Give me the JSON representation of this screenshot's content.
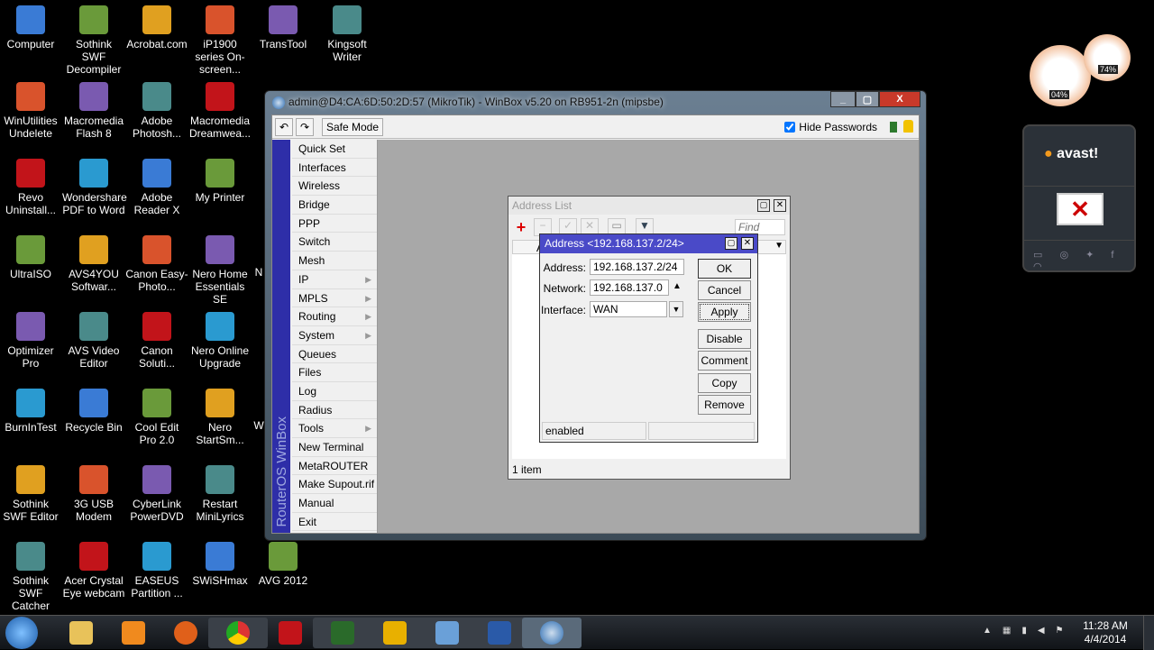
{
  "desktop": {
    "columns": [
      [
        "Computer",
        "WinUtilities Undelete",
        "Revo Uninstall...",
        "UltraISO",
        "Optimizer Pro",
        "BurnInTest",
        "Sothink SWF Editor",
        "Sothink SWF Catcher"
      ],
      [
        "Sothink SWF Decompiler",
        "Macromedia Flash 8",
        "Wondershare PDF to Word",
        "AVS4YOU Softwar...",
        "AVS Video Editor",
        "Recycle Bin",
        "3G USB Modem",
        "Acer Crystal Eye webcam"
      ],
      [
        "Acrobat.com",
        "Adobe Photosh...",
        "Adobe Reader X",
        "Canon Easy-Photo...",
        "Canon Soluti...",
        "Cool Edit Pro 2.0",
        "CyberLink PowerDVD",
        "EASEUS Partition ..."
      ],
      [
        "iP1900 series On-screen...",
        "Macromedia Dreamwea...",
        "My Printer",
        "Nero Home Essentials SE",
        "Nero Online Upgrade",
        "Nero StartSm...",
        "Restart MiniLyrics",
        "SWiSHmax"
      ],
      [
        "TransTool",
        null,
        null,
        "N",
        null,
        "W",
        null,
        "AVG 2012"
      ],
      [
        "Kingsoft Writer"
      ]
    ]
  },
  "winbox": {
    "title": "admin@D4:CA:6D:50:2D:57 (MikroTik) - WinBox v5.20 on RB951-2n (mipsbe)",
    "safe_mode": "Safe Mode",
    "hide_passwords": "Hide Passwords",
    "hide_passwords_checked": true,
    "brand": "RouterOS WinBox",
    "menu": [
      {
        "label": "Quick Set"
      },
      {
        "label": "Interfaces"
      },
      {
        "label": "Wireless"
      },
      {
        "label": "Bridge"
      },
      {
        "label": "PPP"
      },
      {
        "label": "Switch"
      },
      {
        "label": "Mesh"
      },
      {
        "label": "IP",
        "sub": true
      },
      {
        "label": "MPLS",
        "sub": true
      },
      {
        "label": "Routing",
        "sub": true
      },
      {
        "label": "System",
        "sub": true
      },
      {
        "label": "Queues"
      },
      {
        "label": "Files"
      },
      {
        "label": "Log"
      },
      {
        "label": "Radius"
      },
      {
        "label": "Tools",
        "sub": true
      },
      {
        "label": "New Terminal"
      },
      {
        "label": "MetaROUTER"
      },
      {
        "label": "Make Supout.rif"
      },
      {
        "label": "Manual"
      },
      {
        "label": "Exit"
      }
    ]
  },
  "address_list": {
    "title": "Address List",
    "find_placeholder": "Find",
    "status": "1 item",
    "col_a": "A"
  },
  "address_dialog": {
    "title": "Address <192.168.137.2/24>",
    "address_label": "Address:",
    "address": "192.168.137.2/24",
    "network_label": "Network:",
    "network": "192.168.137.0",
    "interface_label": "Interface:",
    "interface": "WAN",
    "buttons": {
      "ok": "OK",
      "cancel": "Cancel",
      "apply": "Apply",
      "disable": "Disable",
      "comment": "Comment",
      "copy": "Copy",
      "remove": "Remove"
    },
    "status": "enabled"
  },
  "gadgets": {
    "cpu": "04%",
    "memory": "74%",
    "avast": "avast!"
  },
  "tray": {
    "time": "11:28 AM",
    "date": "4/4/2014"
  },
  "colors": {
    "dialog_title": "#4a4ac8",
    "winbox_strip": "#2e2ea8"
  }
}
